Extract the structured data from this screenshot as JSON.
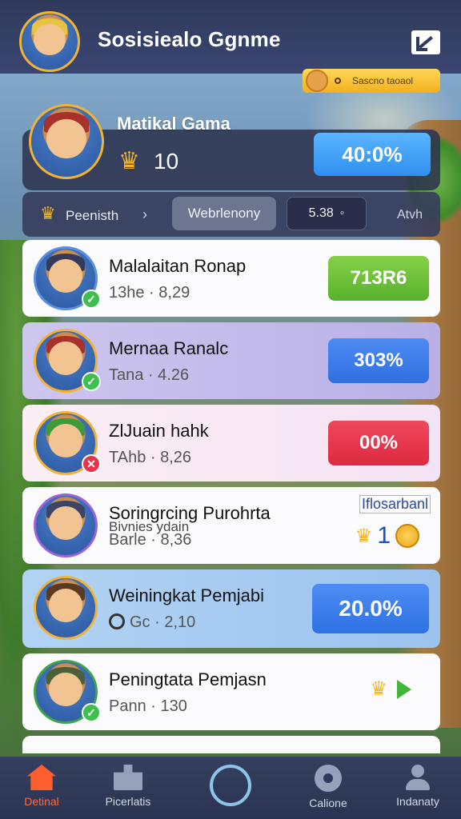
{
  "header": {
    "title": "Sosisiealo Ggnme",
    "season_label": "Sascno taoaol"
  },
  "profile": {
    "name": "Matikal Gama",
    "score": "10",
    "percent": "40:0%"
  },
  "filters": {
    "tab1": "Peenisth",
    "tab2": "Webrlenony",
    "tab3_value": "5.38",
    "tab4": "Atvh"
  },
  "rows": [
    {
      "name": "Malalaitan Ronap",
      "sub": "13he · 8,29",
      "badge": "713R6",
      "badge_color": "#58b12c"
    },
    {
      "name": "Mernaa Ranalc",
      "sub": "Tana · 4.26",
      "badge": "303%",
      "badge_color": "#2f6fe0"
    },
    {
      "name": "ZlJuain hahk",
      "sub": "TAhb · 8,26",
      "badge": "00%",
      "badge_color": "#dd2a40"
    },
    {
      "name": "Soringrcing Purohrta",
      "name_overlap": "Bivnies ydain",
      "sub": "Barle · 8,36",
      "side_label": "Iflosarbanl",
      "coins": "1"
    },
    {
      "name": "Weiningkat Pemjabi",
      "sub": "Gc · 2,10",
      "badge": "20.0%",
      "badge_color": "#2f72e4"
    },
    {
      "name": "Peningtata Pemjasn",
      "sub": "Pann · 130"
    }
  ],
  "nav": {
    "home": "Detinal",
    "puzzle": "Picerlatis",
    "settings": "Calione",
    "profile": "Indanaty"
  }
}
